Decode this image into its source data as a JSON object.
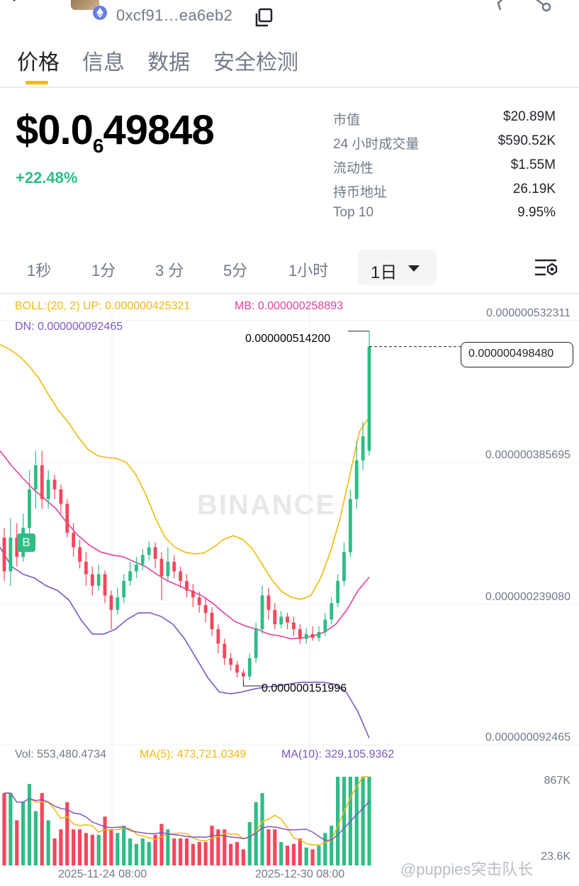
{
  "header": {
    "address": "0xcf91…ea6eb2",
    "icons": [
      "back-arrow-icon",
      "token-avatar",
      "ethereum-icon",
      "copy-icon",
      "star-icon",
      "share-icon"
    ]
  },
  "tabs": [
    {
      "label": "价格",
      "active": true
    },
    {
      "label": "信息",
      "active": false
    },
    {
      "label": "数据",
      "active": false
    },
    {
      "label": "安全检测",
      "active": false
    }
  ],
  "price": {
    "prefix": "$0.0",
    "zeros_sub": "6",
    "digits": "49848",
    "change": "+22.48%"
  },
  "stats": [
    {
      "label": "市值",
      "value": "$20.89M"
    },
    {
      "label": "24 小时成交量",
      "value": "$590.52K"
    },
    {
      "label": "流动性",
      "value": "$1.55M"
    },
    {
      "label": "持币地址",
      "value": "26.19K"
    },
    {
      "label": "Top 10",
      "value": "9.95%"
    }
  ],
  "intervals": {
    "items": [
      "1秒",
      "1分",
      "3 分",
      "5分",
      "1小时"
    ],
    "selected": "1日"
  },
  "indicators": {
    "boll": "BOLL:(20, 2) UP: 0.000000425321",
    "mb": "MB: 0.000000258893",
    "dn": "DN: 0.000000092465",
    "vol": "Vol: 553,480.4734",
    "ma5": "MA(5): 473,721.0349",
    "ma10": "MA(10): 329,105.9362"
  },
  "colors": {
    "up": "#2ebd85",
    "down": "#f6465d",
    "boll_up": "#f0b90b",
    "boll_mb": "#e040a0",
    "boll_dn": "#7e57c2",
    "accent": "#f0b90b"
  },
  "watermark": "BINANCE",
  "footer_mark": "@puppies突击队长",
  "chart_data": {
    "type": "candlestick",
    "price_axis_labels": [
      "0.000000532311",
      "0.000000385695",
      "0.000000239080",
      "0.000000092465"
    ],
    "last_price_label": "0.000000498480",
    "high_label": "0.000000514200",
    "low_label": "0.000000151996",
    "volume_axis_labels": [
      "867K",
      "23.6K"
    ],
    "date_labels": [
      "2025-11-24 08:00",
      "2025-12-30 08:00"
    ],
    "buy_marker": "B",
    "ylim": [
      9.2465e-08,
      5.32311e-07
    ],
    "candles": [
      {
        "o": 3e-07,
        "c": 2.65e-07,
        "h": 3.1e-07,
        "l": 2.55e-07
      },
      {
        "o": 2.65e-07,
        "c": 3e-07,
        "h": 3.2e-07,
        "l": 2.5e-07
      },
      {
        "o": 3e-07,
        "c": 2.8e-07,
        "h": 3.15e-07,
        "l": 2.7e-07
      },
      {
        "o": 2.8e-07,
        "c": 3.1e-07,
        "h": 3.25e-07,
        "l": 2.75e-07
      },
      {
        "o": 3.1e-07,
        "c": 3.5e-07,
        "h": 3.7e-07,
        "l": 3e-07
      },
      {
        "o": 3.5e-07,
        "c": 3.75e-07,
        "h": 3.9e-07,
        "l": 3.3e-07
      },
      {
        "o": 3.75e-07,
        "c": 3.4e-07,
        "h": 3.9e-07,
        "l": 3.3e-07
      },
      {
        "o": 3.4e-07,
        "c": 3.6e-07,
        "h": 3.7e-07,
        "l": 3.3e-07
      },
      {
        "o": 3.6e-07,
        "c": 3.5e-07,
        "h": 3.65e-07,
        "l": 3.4e-07
      },
      {
        "o": 3.5e-07,
        "c": 3.35e-07,
        "h": 3.55e-07,
        "l": 3.25e-07
      },
      {
        "o": 3.35e-07,
        "c": 3.05e-07,
        "h": 3.4e-07,
        "l": 3e-07
      },
      {
        "o": 3.05e-07,
        "c": 2.9e-07,
        "h": 3.15e-07,
        "l": 2.8e-07
      },
      {
        "o": 2.9e-07,
        "c": 2.75e-07,
        "h": 2.98e-07,
        "l": 2.68e-07
      },
      {
        "o": 2.75e-07,
        "c": 2.62e-07,
        "h": 2.85e-07,
        "l": 2.5e-07
      },
      {
        "o": 2.62e-07,
        "c": 2.5e-07,
        "h": 2.7e-07,
        "l": 2.4e-07
      },
      {
        "o": 2.5e-07,
        "c": 2.62e-07,
        "h": 2.72e-07,
        "l": 2.45e-07
      },
      {
        "o": 2.62e-07,
        "c": 2.4e-07,
        "h": 2.66e-07,
        "l": 2.32e-07
      },
      {
        "o": 2.4e-07,
        "c": 2.25e-07,
        "h": 2.45e-07,
        "l": 2.05e-07
      },
      {
        "o": 2.25e-07,
        "c": 2.38e-07,
        "h": 2.48e-07,
        "l": 2.2e-07
      },
      {
        "o": 2.38e-07,
        "c": 2.55e-07,
        "h": 2.62e-07,
        "l": 2.32e-07
      },
      {
        "o": 2.55e-07,
        "c": 2.65e-07,
        "h": 2.75e-07,
        "l": 2.5e-07
      },
      {
        "o": 2.65e-07,
        "c": 2.72e-07,
        "h": 2.8e-07,
        "l": 2.58e-07
      },
      {
        "o": 2.72e-07,
        "c": 2.82e-07,
        "h": 2.88e-07,
        "l": 2.66e-07
      },
      {
        "o": 2.82e-07,
        "c": 2.9e-07,
        "h": 2.96e-07,
        "l": 2.76e-07
      },
      {
        "o": 2.9e-07,
        "c": 2.78e-07,
        "h": 2.95e-07,
        "l": 2.68e-07
      },
      {
        "o": 2.78e-07,
        "c": 2.6e-07,
        "h": 2.85e-07,
        "l": 2.35e-07
      },
      {
        "o": 2.6e-07,
        "c": 2.75e-07,
        "h": 2.9e-07,
        "l": 2.55e-07
      },
      {
        "o": 2.75e-07,
        "c": 2.65e-07,
        "h": 2.82e-07,
        "l": 2.58e-07
      },
      {
        "o": 2.65e-07,
        "c": 2.55e-07,
        "h": 2.7e-07,
        "l": 2.48e-07
      },
      {
        "o": 2.55e-07,
        "c": 2.45e-07,
        "h": 2.62e-07,
        "l": 2.38e-07
      },
      {
        "o": 2.45e-07,
        "c": 2.38e-07,
        "h": 2.52e-07,
        "l": 2.28e-07
      },
      {
        "o": 2.38e-07,
        "c": 2.3e-07,
        "h": 2.44e-07,
        "l": 2.22e-07
      },
      {
        "o": 2.3e-07,
        "c": 2.22e-07,
        "h": 2.38e-07,
        "l": 2.12e-07
      },
      {
        "o": 2.22e-07,
        "c": 2.05e-07,
        "h": 2.28e-07,
        "l": 1.98e-07
      },
      {
        "o": 2.05e-07,
        "c": 1.9e-07,
        "h": 2.1e-07,
        "l": 1.8e-07
      },
      {
        "o": 1.9e-07,
        "c": 1.75e-07,
        "h": 1.95e-07,
        "l": 1.68e-07
      },
      {
        "o": 1.75e-07,
        "c": 1.68e-07,
        "h": 1.8e-07,
        "l": 1.62e-07
      },
      {
        "o": 1.68e-07,
        "c": 1.6e-07,
        "h": 1.72e-07,
        "l": 1.55e-07
      },
      {
        "o": 1.6e-07,
        "c": 1.56e-07,
        "h": 1.63e-07,
        "l": 1.52e-07
      },
      {
        "o": 1.56e-07,
        "c": 1.75e-07,
        "h": 1.8e-07,
        "l": 1.52e-07
      },
      {
        "o": 1.75e-07,
        "c": 2.05e-07,
        "h": 2.12e-07,
        "l": 1.7e-07
      },
      {
        "o": 2.05e-07,
        "c": 2.4e-07,
        "h": 2.5e-07,
        "l": 2e-07
      },
      {
        "o": 2.4e-07,
        "c": 2.25e-07,
        "h": 2.48e-07,
        "l": 2.15e-07
      },
      {
        "o": 2.25e-07,
        "c": 2.1e-07,
        "h": 2.32e-07,
        "l": 2.05e-07
      },
      {
        "o": 2.1e-07,
        "c": 2.18e-07,
        "h": 2.24e-07,
        "l": 2.06e-07
      },
      {
        "o": 2.18e-07,
        "c": 2.12e-07,
        "h": 2.22e-07,
        "l": 2.05e-07
      },
      {
        "o": 2.12e-07,
        "c": 2.05e-07,
        "h": 2.18e-07,
        "l": 1.98e-07
      },
      {
        "o": 2.05e-07,
        "c": 1.95e-07,
        "h": 2.1e-07,
        "l": 1.9e-07
      },
      {
        "o": 1.95e-07,
        "c": 2e-07,
        "h": 2.06e-07,
        "l": 1.9e-07
      },
      {
        "o": 2e-07,
        "c": 1.96e-07,
        "h": 2.08e-07,
        "l": 1.93e-07
      },
      {
        "o": 1.96e-07,
        "c": 2.02e-07,
        "h": 2.08e-07,
        "l": 1.92e-07
      },
      {
        "o": 2.02e-07,
        "c": 2.15e-07,
        "h": 2.22e-07,
        "l": 1.98e-07
      },
      {
        "o": 2.15e-07,
        "c": 2.32e-07,
        "h": 2.38e-07,
        "l": 2.1e-07
      },
      {
        "o": 2.32e-07,
        "c": 2.55e-07,
        "h": 2.62e-07,
        "l": 2.28e-07
      },
      {
        "o": 2.55e-07,
        "c": 2.85e-07,
        "h": 2.95e-07,
        "l": 2.5e-07
      },
      {
        "o": 2.85e-07,
        "c": 3.4e-07,
        "h": 3.5e-07,
        "l": 2.8e-07
      },
      {
        "o": 3.4e-07,
        "c": 3.8e-07,
        "h": 4e-07,
        "l": 3.3e-07
      },
      {
        "o": 3.8e-07,
        "c": 4.05e-07,
        "h": 4.2e-07,
        "l": 3.7e-07
      },
      {
        "o": 3.9e-07,
        "c": 4.98e-07,
        "h": 5.14e-07,
        "l": 3.85e-07
      }
    ],
    "boll_up": [
      5e-07,
      4.95e-07,
      4.88e-07,
      4.78e-07,
      4.65e-07,
      4.48e-07,
      4.32e-07,
      4.2e-07,
      4.05e-07,
      3.92e-07,
      3.85e-07,
      3.83e-07,
      3.82e-07,
      3.78e-07,
      3.65e-07,
      3.45e-07,
      3.2e-07,
      3e-07,
      2.9e-07,
      2.85e-07,
      2.83e-07,
      2.84e-07,
      2.9e-07,
      2.98e-07,
      3.02e-07,
      2.98e-07,
      2.88e-07,
      2.72e-07,
      2.56e-07,
      2.44e-07,
      2.38e-07,
      2.36e-07,
      2.4e-07,
      2.58e-07,
      2.85e-07,
      3.2e-07,
      3.65e-07,
      4.1e-07,
      4.25e-07
    ],
    "boll_mb": [
      3.9e-07,
      3.75e-07,
      3.62e-07,
      3.5e-07,
      3.4e-07,
      3.3e-07,
      3.15e-07,
      3.02e-07,
      2.92e-07,
      2.85e-07,
      2.82e-07,
      2.8e-07,
      2.75e-07,
      2.7e-07,
      2.62e-07,
      2.55e-07,
      2.5e-07,
      2.45e-07,
      2.4e-07,
      2.32e-07,
      2.22e-07,
      2.13e-07,
      2.08e-07,
      2.05e-07,
      2e-07,
      1.98e-07,
      1.95e-07,
      1.96e-07,
      1.98e-07,
      2.02e-07,
      2.1e-07,
      2.25e-07,
      2.45e-07,
      2.59e-07
    ],
    "boll_dn": [
      2.9e-07,
      2.7e-07,
      2.62e-07,
      2.58e-07,
      2.5e-07,
      2.45e-07,
      2.35e-07,
      2.15e-07,
      2e-07,
      2e-07,
      2.05e-07,
      2.15e-07,
      2.22e-07,
      2.22e-07,
      2.18e-07,
      2.1e-07,
      1.95e-07,
      1.75e-07,
      1.55e-07,
      1.4e-07,
      1.38e-07,
      1.4e-07,
      1.43e-07,
      1.45e-07,
      1.46e-07,
      1.48e-07,
      1.5e-07,
      1.5e-07,
      1.5e-07,
      1.48e-07,
      1.4e-07,
      1.2e-07,
      9.2e-08
    ]
  }
}
